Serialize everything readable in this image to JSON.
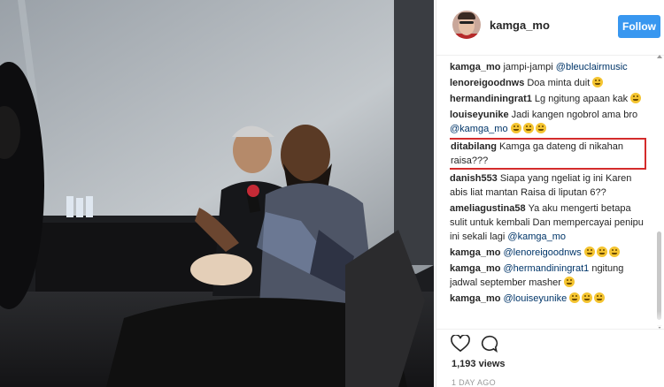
{
  "post": {
    "username": "kamga_mo",
    "follow_label": "Follow",
    "views": "1,193 views",
    "time_ago": "1 DAY AGO"
  },
  "comments": [
    {
      "user": "kamga_mo",
      "parts": [
        {
          "t": "jampi-jampi "
        },
        {
          "m": "@bleuclairmusic"
        }
      ]
    },
    {
      "user": "lenoreigoodnws",
      "parts": [
        {
          "t": "Doa minta duit "
        },
        {
          "e": "laugh"
        }
      ]
    },
    {
      "user": "hermandiningrat1",
      "parts": [
        {
          "t": "Lg ngitung apaan kak "
        },
        {
          "e": "grin"
        }
      ]
    },
    {
      "user": "louiseyunike",
      "parts": [
        {
          "t": "Jadi kangen ngobrol ama bro "
        },
        {
          "m": "@kamga_mo"
        },
        {
          "t": " "
        },
        {
          "e": "laugh"
        },
        {
          "e": "laugh"
        },
        {
          "e": "laugh"
        }
      ]
    },
    {
      "user": "ditabilang",
      "highlight": true,
      "parts": [
        {
          "t": "Kamga ga dateng di nikahan raisa???"
        }
      ]
    },
    {
      "user": "danish553",
      "parts": [
        {
          "t": "Siapa yang ngeliat ig ini Karen abis liat mantan Raisa di liputan 6??"
        }
      ]
    },
    {
      "user": "ameliagustina58",
      "parts": [
        {
          "t": "Ya aku mengerti betapa sulit untuk kembali Dan mempercayai penipu ini sekali lagi "
        },
        {
          "m": "@kamga_mo"
        }
      ]
    },
    {
      "user": "kamga_mo",
      "parts": [
        {
          "m": "@lenoreigoodnws"
        },
        {
          "t": " "
        },
        {
          "e": "laugh"
        },
        {
          "e": "laugh"
        },
        {
          "e": "laugh"
        }
      ]
    },
    {
      "user": "kamga_mo",
      "parts": [
        {
          "m": "@hermandiningrat1"
        },
        {
          "t": " ngitung jadwal september masher "
        },
        {
          "e": "grin"
        }
      ]
    },
    {
      "user": "kamga_mo",
      "parts": [
        {
          "m": "@louiseyunike"
        },
        {
          "t": " "
        },
        {
          "e": "laugh"
        },
        {
          "e": "laugh"
        },
        {
          "e": "laugh"
        }
      ]
    }
  ],
  "icons": {
    "heart": "heart-icon",
    "comment": "comment-icon",
    "emoji_laugh": "laughing-face-icon",
    "emoji_grin": "grinning-face-icon"
  },
  "colors": {
    "follow_button": "#3897f0",
    "highlight_border": "#d42b2b",
    "mention": "#003569"
  }
}
